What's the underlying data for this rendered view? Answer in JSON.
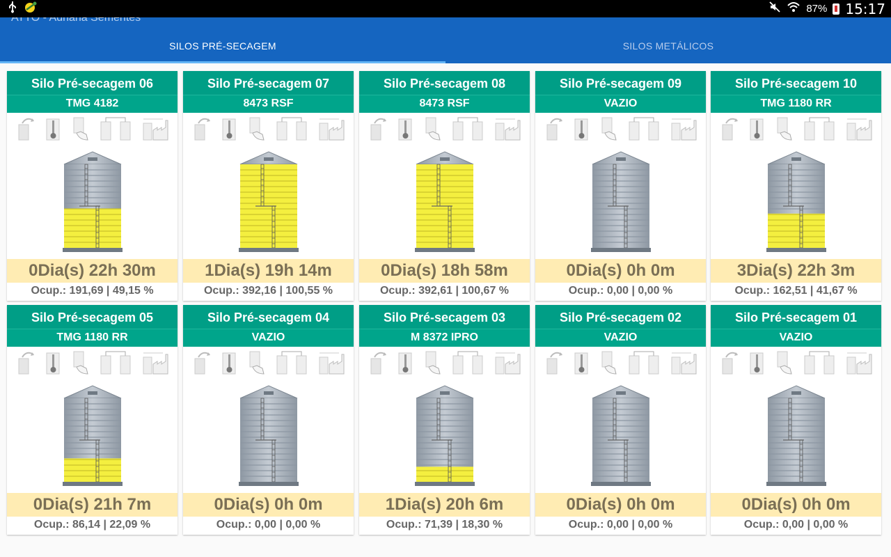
{
  "status": {
    "battery": "87%",
    "time": "15:17"
  },
  "app": {
    "title": "ATTO - Adriana Sementes"
  },
  "tabs": [
    {
      "label": "SILOS PRÉ-SECAGEM",
      "active": true
    },
    {
      "label": "SILOS METÁLICOS",
      "active": false
    }
  ],
  "colors": {
    "header": "#009e86",
    "fill": "#f4ef3f",
    "appbar": "#1565c0",
    "time_bg": "#ffecb3"
  },
  "silos": [
    {
      "name": "Silo Pré-secagem 06",
      "product": "TMG 4182",
      "time": "0Dia(s) 22h 30m",
      "occupancy": "Ocup.: 191,69 | 49,15 %",
      "fill_fraction": 0.47
    },
    {
      "name": "Silo Pré-secagem 07",
      "product": "8473 RSF",
      "time": "1Dia(s) 19h 14m",
      "occupancy": "Ocup.: 392,16 | 100,55 %",
      "fill_fraction": 1.0
    },
    {
      "name": "Silo Pré-secagem 08",
      "product": "8473 RSF",
      "time": "0Dia(s) 18h 58m",
      "occupancy": "Ocup.: 392,61 | 100,67 %",
      "fill_fraction": 1.0
    },
    {
      "name": "Silo Pré-secagem 09",
      "product": "VAZIO",
      "time": "0Dia(s) 0h 0m",
      "occupancy": "Ocup.: 0,00 | 0,00 %",
      "fill_fraction": 0.0
    },
    {
      "name": "Silo Pré-secagem 10",
      "product": "TMG 1180 RR",
      "time": "3Dia(s) 22h 3m",
      "occupancy": "Ocup.: 162,51 | 41,67 %",
      "fill_fraction": 0.41
    },
    {
      "name": "Silo Pré-secagem 05",
      "product": "TMG 1180 RR",
      "time": "0Dia(s) 21h 7m",
      "occupancy": "Ocup.: 86,14 | 22,09 %",
      "fill_fraction": 0.28
    },
    {
      "name": "Silo Pré-secagem 04",
      "product": "VAZIO",
      "time": "0Dia(s) 0h 0m",
      "occupancy": "Ocup.: 0,00 | 0,00 %",
      "fill_fraction": 0.0
    },
    {
      "name": "Silo Pré-secagem 03",
      "product": "M 8372 IPRO",
      "time": "1Dia(s) 20h 6m",
      "occupancy": "Ocup.: 71,39 | 18,30 %",
      "fill_fraction": 0.18
    },
    {
      "name": "Silo Pré-secagem 02",
      "product": "VAZIO",
      "time": "0Dia(s) 0h 0m",
      "occupancy": "Ocup.: 0,00 | 0,00 %",
      "fill_fraction": 0.0
    },
    {
      "name": "Silo Pré-secagem 01",
      "product": "VAZIO",
      "time": "0Dia(s) 0h 0m",
      "occupancy": "Ocup.: 0,00 | 0,00 %",
      "fill_fraction": 0.0
    }
  ]
}
